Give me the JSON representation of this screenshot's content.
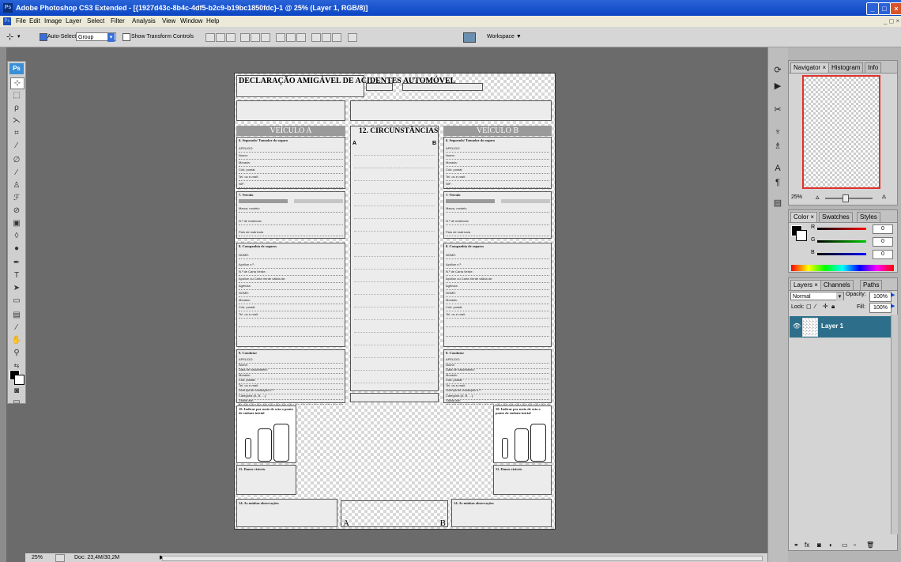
{
  "window": {
    "title": "Adobe Photoshop CS3 Extended - [{1927d43c-8b4c-4df5-b2c9-b19bc1850fdc}-1 @ 25% (Layer 1, RGB/8)]",
    "app_badge": "Ps"
  },
  "menu": [
    "File",
    "Edit",
    "Image",
    "Layer",
    "Select",
    "Filter",
    "Analysis",
    "View",
    "Window",
    "Help"
  ],
  "options": {
    "auto_select_label": "Auto-Select:",
    "auto_select_value": "Group",
    "show_transform_label": "Show Transform Controls",
    "workspace_label": "Workspace ▼"
  },
  "document": {
    "title": "DECLARAÇÃO AMIGÁVEL DE ACIDENTES AUTOMÓVEL",
    "vehicle_a": "VEÍCULO A",
    "vehicle_b": "VEÍCULO B",
    "circumstances": "12. CIRCUNSTÂNCIAS",
    "section_insured": "6. Segurado/ Tomador do seguro",
    "section_vehicle": "7. Veículo",
    "section_insurer": "8. Companhia de seguros",
    "section_driver": "9. Condutor",
    "section_impact": "10. Indicar por meio de seta o ponto de embate inicial",
    "section_damage": "11. Danos visíveis",
    "section_observations": "14. As minhas observações",
    "fields_insured": [
      "APELIDO:",
      "Nome:",
      "Morada:",
      "Cód. postal:",
      "Tel. ou e-mail:",
      "NIF:"
    ],
    "fields_vehicle": [
      "Marca, modelo",
      "N.º de matrícula",
      "País de matrícula"
    ],
    "fields_insurer": [
      "NOME:",
      "Apólice n.º:",
      "N.º de Carta Verde:",
      "Apólice ou Carta Verde válida de:",
      "Agência:",
      "NOME:",
      "Morada:",
      "Cód. postal:",
      "Tel. ou e-mail:"
    ],
    "fields_driver": [
      "APELIDO:",
      "Nome:",
      "Data de nascimento:",
      "Morada:",
      "Cód. postal:",
      "Tel. ou e-mail:",
      "Licença de condução n.º:",
      "Categoria (A, B, ...):",
      "Válida até:"
    ],
    "letter_a": "A",
    "letter_b": "B"
  },
  "panels": {
    "navigator_tabs": [
      "Navigator ×",
      "Histogram",
      "Info"
    ],
    "zoom": "25%",
    "color_tabs": [
      "Color ×",
      "Swatches",
      "Styles"
    ],
    "color_channels": [
      {
        "label": "R",
        "value": "0"
      },
      {
        "label": "G",
        "value": "0"
      },
      {
        "label": "B",
        "value": "0"
      }
    ],
    "layers_tabs": [
      "Layers ×",
      "Channels",
      "Paths"
    ],
    "blend_mode": "Normal",
    "opacity_label": "Opacity:",
    "opacity_value": "100%",
    "lock_label": "Lock:",
    "fill_label": "Fill:",
    "fill_value": "100%",
    "layer_name": "Layer 1"
  },
  "status": {
    "zoom": "25%",
    "doc": "Doc: 23,4M/30,2M"
  },
  "colors": {
    "titlebar": "#0b45c4",
    "layer_selected": "#2d6f8a"
  }
}
